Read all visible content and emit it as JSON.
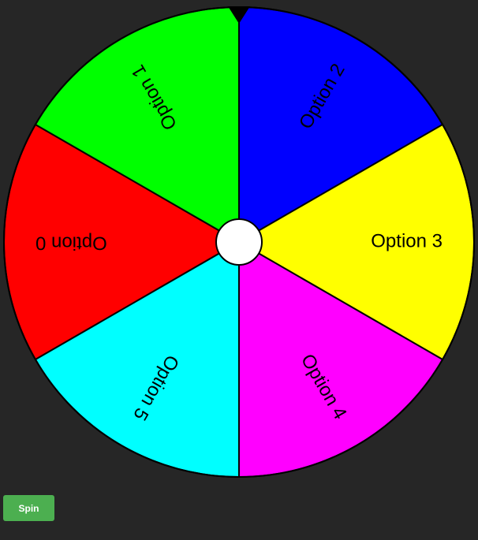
{
  "wheel": {
    "rotation_deg": 150,
    "border_color": "#000000",
    "hub_color": "#ffffff",
    "pointer_color": "#000000",
    "slices": [
      {
        "label": "Option 0",
        "color": "#ff0000"
      },
      {
        "label": "Option 1",
        "color": "#00ff00"
      },
      {
        "label": "Option 2",
        "color": "#0000ff"
      },
      {
        "label": "Option 3",
        "color": "#ffff00"
      },
      {
        "label": "Option 4",
        "color": "#ff00ff"
      },
      {
        "label": "Option 5",
        "color": "#00ffff"
      }
    ]
  },
  "controls": {
    "spin_label": "Spin",
    "spin_color": "#4caf50"
  }
}
